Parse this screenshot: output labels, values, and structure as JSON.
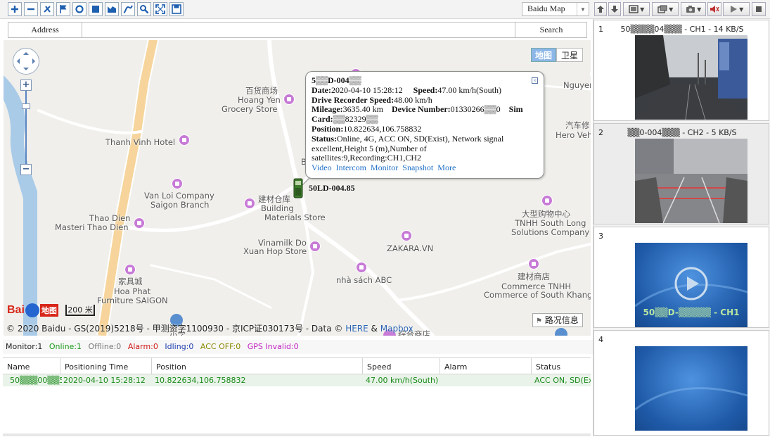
{
  "toolbar": {
    "map_type": "Baidu Map"
  },
  "search": {
    "address_label": "Address",
    "address_value": "",
    "button": "Search"
  },
  "map": {
    "maptype_map": "地图",
    "maptype_satellite": "卫星",
    "scale": "200 米",
    "traffic": "路况信息",
    "logo_text": "Bai",
    "logo_du": "地图",
    "copyright_pre": "© 2020 Baidu - GS(2019)5218号 - 甲测资字1100930 - 京ICP证030173号 - Data © ",
    "copyright_here": "HERE",
    "copyright_amp": " & ",
    "copyright_mapbox": "Mapbox",
    "labels": {
      "bach_hoa_cn": "百货商场",
      "hoang_yen": "Hoang Yen",
      "grocery": "Grocery Store",
      "thanh_vinh": "Thanh Vinh Hotel",
      "van_loi_1": "Van Loi Company",
      "van_loi_2": "Saigon Branch",
      "building_cn": "建材仓库",
      "building_1": "Building",
      "building_2": "Materials Store",
      "thao_dien_1": "Thao Dien",
      "thao_dien_2": "Masteri Thao Dien",
      "vinamilk_1": "Vinamilk Do",
      "vinamilk_2": "Xuan Hop Store",
      "zakara": "ZAKARA.VN",
      "nha_sach": "nhà sách ABC",
      "furniture_cn": "家具城",
      "furniture_1": "Hoa Phat",
      "furniture_2": "Furniture SAIGON",
      "tnhh_cn": "大型购物中心",
      "tnhh_1": "TNHH South Long",
      "tnhh_2": "Solutions Company",
      "commerce_cn": "建材商店",
      "commerce_1": "Commerce TNHH",
      "commerce_2": "Commerce of South Khang",
      "nguyen": "Nguyen",
      "hero_cn": "汽车修",
      "hero": "Hero Vehi",
      "bottom_cn": "综合商店",
      "b_letter": "B",
      "small_cn": "小学"
    }
  },
  "popup": {
    "plate": "5▒▒D-004▒▒",
    "date_label": "Date:",
    "date": "2020-04-10 15:28:12",
    "speed_label": "Speed:",
    "speed": "47.00 km/h(South)",
    "drs_label": "Drive Recorder Speed:",
    "drs": "48.00 km/h",
    "mileage_label": "Mileage:",
    "mileage": "3635.40 km",
    "device_label": "Device Number:",
    "device": "01330266▒▒0",
    "sim_label": "Sim",
    "card_label": "Card:",
    "card": "▒▒82329▒▒",
    "position_label": "Position:",
    "position": "10.822634,106.758832",
    "status_label": "Status:",
    "status": "Online, 4G, ACC ON, SD(Exist), Network signal excellent,Height 5 (m),Number of satellites:9,Recording:CH1,CH2",
    "links": [
      "Video",
      "Intercom",
      "Monitor",
      "Snapshot",
      "More"
    ]
  },
  "vehicle_label": "50LD-004.85",
  "status_bar": {
    "monitor": "Monitor:1",
    "online": "Online:1",
    "offline": "Offline:0",
    "alarm": "Alarm:0",
    "idling": "Idling:0",
    "acc_off": "ACC OFF:0",
    "gps_invalid": "GPS Invalid:0",
    "colors": {
      "online": "#1a9a1a",
      "offline": "#777777",
      "alarm": "#d01818",
      "idling": "#1f3fb0",
      "acc_off": "#8a8a00",
      "gps_invalid": "#c020c0"
    }
  },
  "table": {
    "headers": [
      "Name",
      "Positioning Time",
      "Position",
      "Speed",
      "Alarm",
      "Status"
    ],
    "row": {
      "name": "50▒▒▒00▒▒5",
      "time": "2020-04-10 15:28:12",
      "position": "10.822634,106.758832",
      "speed": "47.00 km/h(South)",
      "alarm": "",
      "status": "ACC ON, SD(Exis"
    }
  },
  "video": {
    "cells": [
      {
        "num": "1",
        "title": "50▒▒▒▒04▒▒▒ - CH1 - 14 KB/S"
      },
      {
        "num": "2",
        "title": "▒▒0-004▒▒▒ - CH2 - 5 KB/S"
      },
      {
        "num": "3",
        "title": "",
        "overlay": "50▒▒D-▒▒▒▒▒ - CH1"
      },
      {
        "num": "4",
        "title": ""
      }
    ]
  }
}
